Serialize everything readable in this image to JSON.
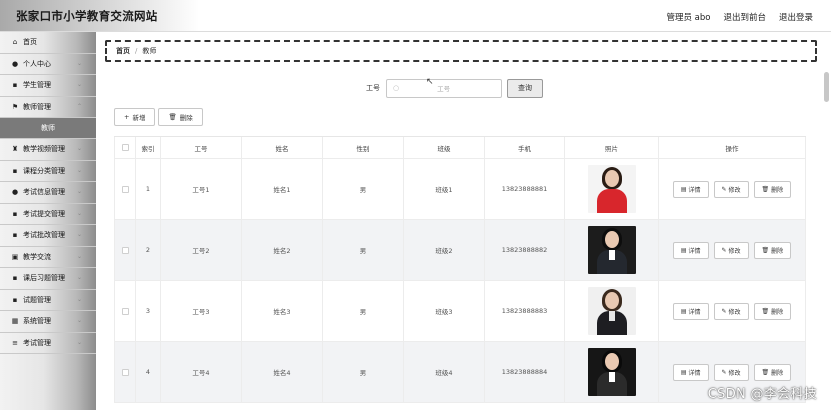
{
  "header": {
    "site_title": "张家口市小学教育交流网站",
    "admin_label": "管理员 abo",
    "exit_front": "退出到前台",
    "logout": "退出登录"
  },
  "sidebar": {
    "items": [
      {
        "label": "首页",
        "icon": "home-icon",
        "glyph": "⌂"
      },
      {
        "label": "个人中心",
        "icon": "user-icon",
        "glyph": "👤"
      },
      {
        "label": "学生管理",
        "icon": "grid-icon",
        "glyph": "▪"
      },
      {
        "label": "教师管理",
        "icon": "flag-icon",
        "glyph": "⚑"
      },
      {
        "label": "教师",
        "icon": "",
        "glyph": ""
      },
      {
        "label": "教学视频管理",
        "icon": "trophy-icon",
        "glyph": "▾"
      },
      {
        "label": "课程分类管理",
        "icon": "grid-icon",
        "glyph": "▪"
      },
      {
        "label": "考试信息管理",
        "icon": "pin-icon",
        "glyph": "●"
      },
      {
        "label": "考试提交管理",
        "icon": "grid-icon",
        "glyph": "▪"
      },
      {
        "label": "考试批改管理",
        "icon": "grid-icon",
        "glyph": "▪"
      },
      {
        "label": "教学交流",
        "icon": "check-icon",
        "glyph": "▣"
      },
      {
        "label": "课后习题管理",
        "icon": "grid-icon",
        "glyph": "▪"
      },
      {
        "label": "试题管理",
        "icon": "grid-icon",
        "glyph": "▪"
      },
      {
        "label": "系统管理",
        "icon": "table-icon",
        "glyph": "▦"
      },
      {
        "label": "考试管理",
        "icon": "list-icon",
        "glyph": "≡"
      }
    ]
  },
  "breadcrumb": {
    "home": "首页",
    "sep": "/",
    "current": "教师"
  },
  "search": {
    "label": "工号",
    "placeholder": "工号",
    "button": "查询"
  },
  "actions": {
    "add": "新增",
    "delete": "删除"
  },
  "table": {
    "headers": [
      "",
      "索引",
      "工号",
      "姓名",
      "性别",
      "班级",
      "手机",
      "照片",
      "操作"
    ],
    "rows": [
      {
        "index": "1",
        "id": "工号1",
        "name": "姓名1",
        "gender": "男",
        "class": "班级1",
        "phone": "13823888881"
      },
      {
        "index": "2",
        "id": "工号2",
        "name": "姓名2",
        "gender": "男",
        "class": "班级2",
        "phone": "13823888882"
      },
      {
        "index": "3",
        "id": "工号3",
        "name": "姓名3",
        "gender": "男",
        "class": "班级3",
        "phone": "13823888883"
      },
      {
        "index": "4",
        "id": "工号4",
        "name": "姓名4",
        "gender": "男",
        "class": "班级4",
        "phone": "13823888884"
      }
    ],
    "ops": {
      "detail": "详情",
      "edit": "修改",
      "delete": "删除"
    }
  },
  "watermark": "CSDN @李会科技",
  "colors": {
    "sidebar_active": "#7a7a7a",
    "striped_row": "#f2f3f5",
    "search_button_bg": "#ebebeb"
  }
}
